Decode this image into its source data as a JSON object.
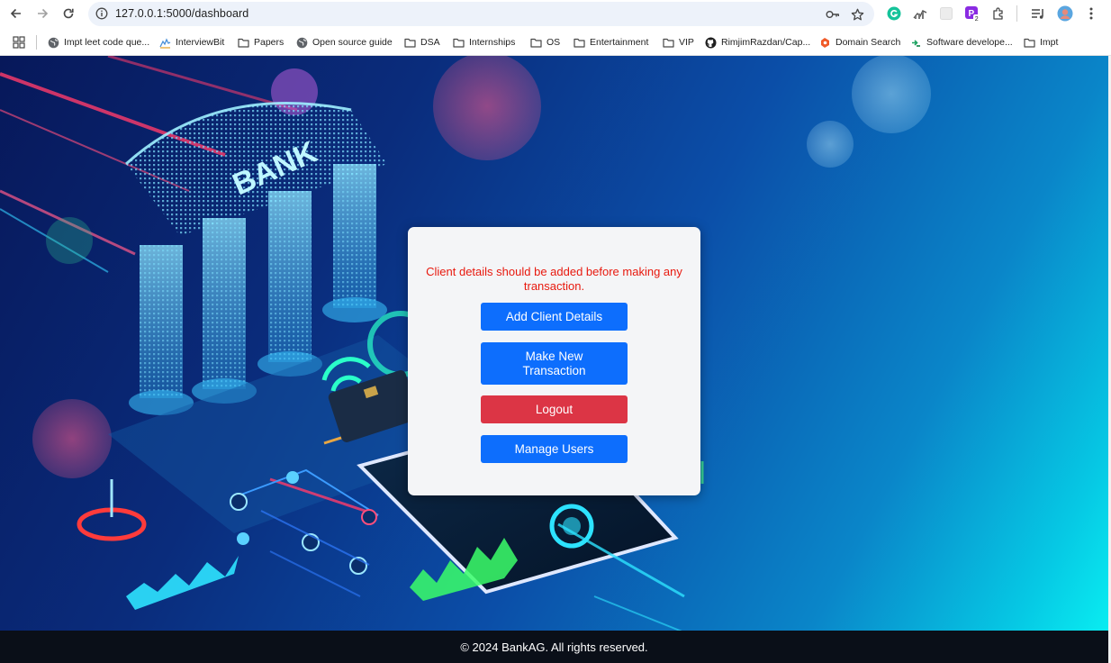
{
  "browser": {
    "url": "127.0.0.1:5000/dashboard",
    "profile_initial": "",
    "extension_badge": "2"
  },
  "bookmarks": [
    {
      "label": "Impt leet code que...",
      "icon": "globe-icon"
    },
    {
      "label": "InterviewBit",
      "icon": "interviewbit-icon"
    },
    {
      "label": "Papers",
      "icon": "folder-icon"
    },
    {
      "label": "Open source guide",
      "icon": "globe-icon"
    },
    {
      "label": "DSA",
      "icon": "folder-icon"
    },
    {
      "label": "Internships",
      "icon": "folder-icon"
    },
    {
      "label": "OS",
      "icon": "folder-icon"
    },
    {
      "label": "Entertainment",
      "icon": "folder-icon"
    },
    {
      "label": "VIP",
      "icon": "folder-icon"
    },
    {
      "label": "RimjimRazdan/Cap...",
      "icon": "github-icon"
    },
    {
      "label": "Domain Search",
      "icon": "domain-search-icon"
    },
    {
      "label": "Software develope...",
      "icon": "software-icon"
    },
    {
      "label": "Impt",
      "icon": "folder-icon"
    }
  ],
  "hero": {
    "sign_text": "BANK"
  },
  "dashboard": {
    "notice": "Client details should be added before making any transaction.",
    "add_client_label": "Add Client Details",
    "new_transaction_label": "Make New Transaction",
    "logout_label": "Logout",
    "manage_users_label": "Manage Users"
  },
  "footer": {
    "text": "© 2024 BankAG. All rights reserved."
  },
  "colors": {
    "primary_button": "#0d6efd",
    "danger_button": "#dc3545",
    "notice_text": "#e8190e",
    "footer_bg": "#0a0f18"
  }
}
